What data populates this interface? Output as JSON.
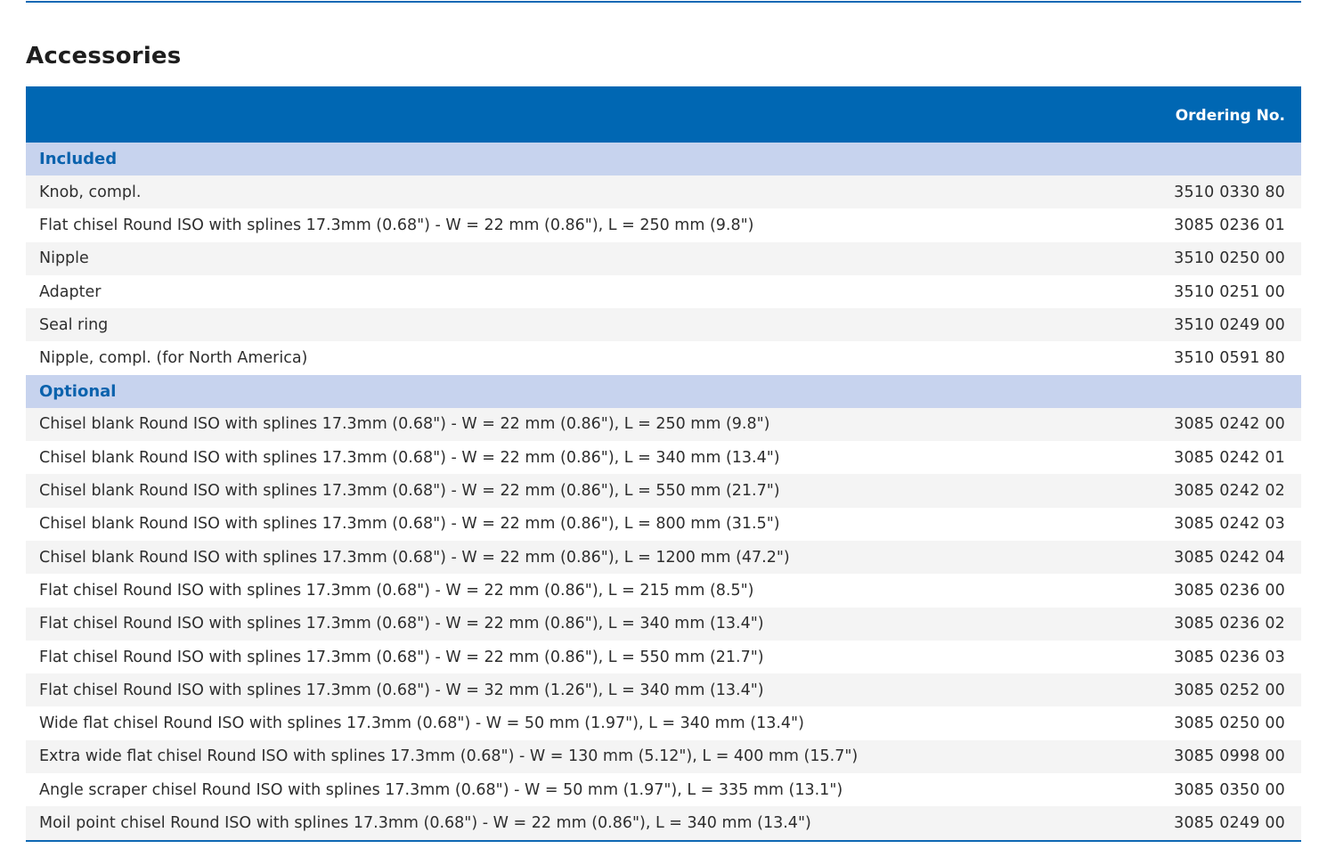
{
  "page": {
    "title": "Accessories"
  },
  "table": {
    "header": {
      "ordering_label": "Ordering No."
    },
    "sections": [
      {
        "label": "Included",
        "rows": [
          {
            "description": "Knob, compl.",
            "code": "3510 0330 80"
          },
          {
            "description": "Flat chisel Round ISO with splines 17.3mm (0.68\") - W = 22 mm (0.86\"), L = 250 mm (9.8\")",
            "code": "3085 0236 01"
          },
          {
            "description": "Nipple",
            "code": "3510 0250 00"
          },
          {
            "description": "Adapter",
            "code": "3510 0251 00"
          },
          {
            "description": "Seal ring",
            "code": "3510 0249 00"
          },
          {
            "description": "Nipple, compl. (for North America)",
            "code": "3510 0591 80"
          }
        ]
      },
      {
        "label": "Optional",
        "rows": [
          {
            "description": "Chisel blank Round ISO with splines 17.3mm (0.68\") - W = 22 mm (0.86\"), L = 250 mm (9.8\")",
            "code": "3085 0242 00"
          },
          {
            "description": "Chisel blank Round ISO with splines 17.3mm (0.68\") - W = 22 mm (0.86\"), L = 340 mm (13.4\")",
            "code": "3085 0242 01"
          },
          {
            "description": "Chisel blank Round ISO with splines 17.3mm (0.68\") - W = 22 mm (0.86\"), L = 550 mm (21.7\")",
            "code": "3085 0242 02"
          },
          {
            "description": "Chisel blank Round ISO with splines 17.3mm (0.68\") - W = 22 mm (0.86\"), L = 800 mm (31.5\")",
            "code": "3085 0242 03"
          },
          {
            "description": "Chisel blank Round ISO with splines 17.3mm (0.68\") - W = 22 mm (0.86\"), L = 1200 mm (47.2\")",
            "code": "3085 0242 04"
          },
          {
            "description": "Flat chisel Round ISO with splines 17.3mm (0.68\") - W = 22 mm (0.86\"), L = 215 mm (8.5\")",
            "code": "3085 0236 00"
          },
          {
            "description": "Flat chisel Round ISO with splines 17.3mm (0.68\") - W = 22 mm (0.86\"), L = 340 mm (13.4\")",
            "code": "3085 0236 02"
          },
          {
            "description": "Flat chisel Round ISO with splines 17.3mm (0.68\") - W = 22 mm (0.86\"), L = 550 mm (21.7\")",
            "code": "3085 0236 03"
          },
          {
            "description": "Flat chisel Round ISO with splines 17.3mm (0.68\") - W = 32 mm (1.26\"), L = 340 mm (13.4\")",
            "code": "3085 0252 00"
          },
          {
            "description": "Wide flat chisel Round ISO with splines 17.3mm (0.68\") - W = 50 mm (1.97\"), L = 340 mm (13.4\")",
            "code": "3085 0250 00"
          },
          {
            "description": "Extra wide flat chisel Round ISO with splines 17.3mm (0.68\") - W = 130 mm (5.12\"), L = 400 mm (15.7\")",
            "code": "3085 0998 00"
          },
          {
            "description": "Angle scraper chisel Round ISO with splines 17.3mm (0.68\") - W = 50 mm (1.97\"), L = 335 mm (13.1\")",
            "code": "3085 0350 00"
          },
          {
            "description": "Moil point chisel Round ISO with splines 17.3mm (0.68\") - W = 22 mm (0.86\"), L = 340 mm (13.4\")",
            "code": "3085 0249 00"
          }
        ]
      }
    ]
  },
  "colors": {
    "header_blue": "#0067b3",
    "section_band": "#c7d3ee",
    "section_text": "#0a62ad",
    "row_shade": "#f4f4f4",
    "rule_blue": "#0f68b4"
  }
}
